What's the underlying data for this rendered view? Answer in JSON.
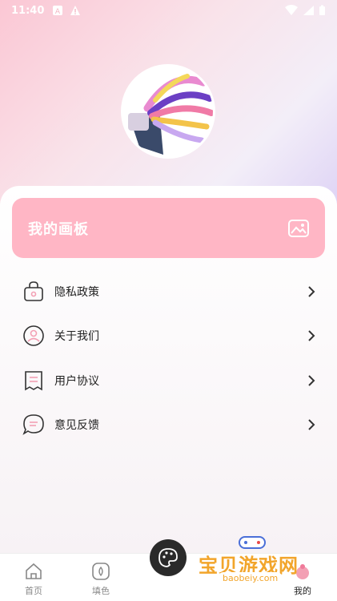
{
  "status_bar": {
    "time": "11:40"
  },
  "banner": {
    "title": "我的画板",
    "icon": "image-icon"
  },
  "menu": [
    {
      "label": "隐私政策",
      "icon": "lock-bag-icon"
    },
    {
      "label": "关于我们",
      "icon": "user-circle-icon"
    },
    {
      "label": "用户协议",
      "icon": "document-icon"
    },
    {
      "label": "意见反馈",
      "icon": "chat-icon"
    }
  ],
  "tabbar": {
    "items": [
      {
        "label": "首页",
        "icon": "home-icon"
      },
      {
        "label": "填色",
        "icon": "fill-icon"
      },
      {
        "label": "",
        "icon": "palette-icon"
      },
      {
        "label": "我的",
        "icon": "profile-icon"
      }
    ]
  },
  "watermark": {
    "text": "宝贝游戏网",
    "url": "baobeiy.com"
  },
  "colors": {
    "accent": "#ffb6c5",
    "tab_active": "#222222"
  }
}
